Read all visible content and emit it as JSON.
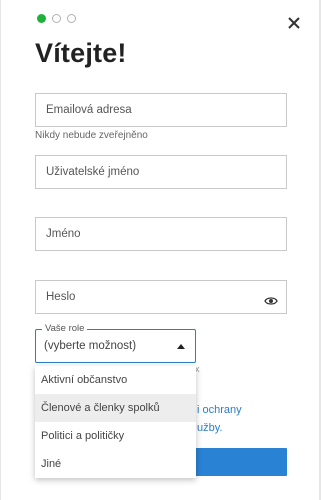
{
  "wizard": {
    "step_count": 3,
    "active_step": 1
  },
  "title": "Vítejte!",
  "email": {
    "placeholder": "Emailová adresa",
    "hint": "Nikdy nebude zveřejněno"
  },
  "username": {
    "placeholder": "Uživatelské jméno"
  },
  "name": {
    "placeholder": "Jméno"
  },
  "password": {
    "placeholder": "Heslo"
  },
  "role": {
    "legend": "Vaše role",
    "selected": "(vyberte možnost)",
    "options": [
      "Aktivní občanstvo",
      "Členové a členky spolků",
      "Politici a političky",
      "Jiné"
    ],
    "hovered_index": 1
  },
  "consent_partial": {
    "line1": "i ochrany",
    "line2": "užby."
  },
  "colors": {
    "accent": "#2a82d4",
    "step_active": "#20b13a"
  },
  "icons": {
    "close": "close-icon",
    "eye": "eye-icon",
    "caret": "caret-up-icon"
  }
}
